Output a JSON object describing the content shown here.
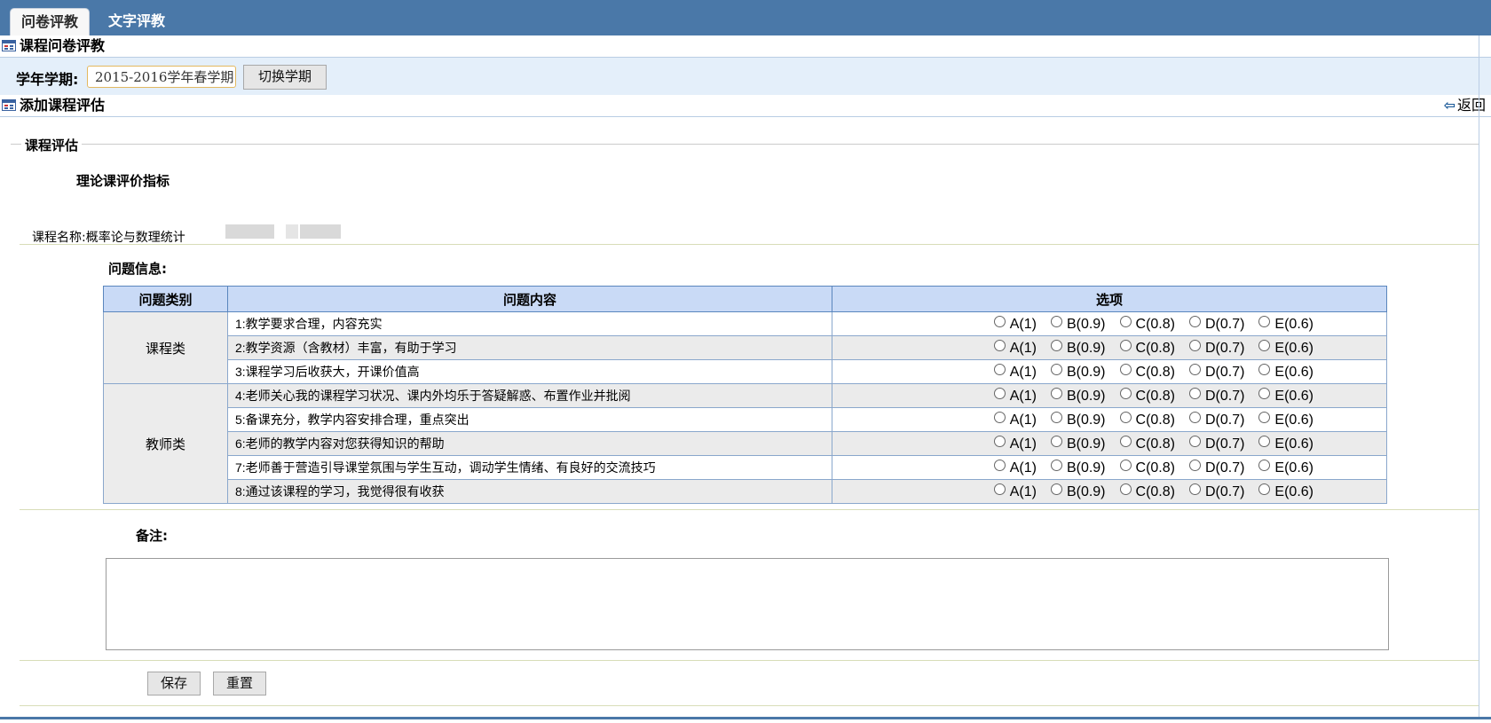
{
  "tabs": [
    {
      "label": "问卷评教",
      "active": true
    },
    {
      "label": "文字评教",
      "active": false
    }
  ],
  "section1": {
    "title": "课程问卷评教"
  },
  "term": {
    "label": "学年学期:",
    "value": "2015-2016学年春学期",
    "switch_label": "切换学期"
  },
  "section2": {
    "title": "添加课程评估",
    "back_label": "返回"
  },
  "fieldset": {
    "legend": "课程评估"
  },
  "index_title": "理论课评价指标",
  "course": {
    "label": "课程名称:概率论与数理统计"
  },
  "questions_label": "问题信息:",
  "table": {
    "headers": [
      "问题类别",
      "问题内容",
      "选项"
    ],
    "option_labels": [
      "A(1)",
      "B(0.9)",
      "C(0.8)",
      "D(0.7)",
      "E(0.6)"
    ],
    "groups": [
      {
        "category": "课程类",
        "questions": [
          "1:教学要求合理，内容充实",
          "2:教学资源（含教材）丰富，有助于学习",
          "3:课程学习后收获大，开课价值高"
        ]
      },
      {
        "category": "教师类",
        "questions": [
          "4:老师关心我的课程学习状况、课内外均乐于答疑解惑、布置作业并批阅",
          "5:备课充分，教学内容安排合理，重点突出",
          "6:老师的教学内容对您获得知识的帮助",
          "7:老师善于营造引导课堂氛围与学生互动，调动学生情绪、有良好的交流技巧",
          "8:通过该课程的学习，我觉得很有收获"
        ]
      }
    ]
  },
  "remark": {
    "label": "备注:",
    "value": ""
  },
  "buttons": {
    "save": "保存",
    "reset": "重置"
  },
  "colors": {
    "tabbar": "#4a78a8",
    "table_header": "#c9daf6",
    "term_bar": "#e4effa"
  }
}
